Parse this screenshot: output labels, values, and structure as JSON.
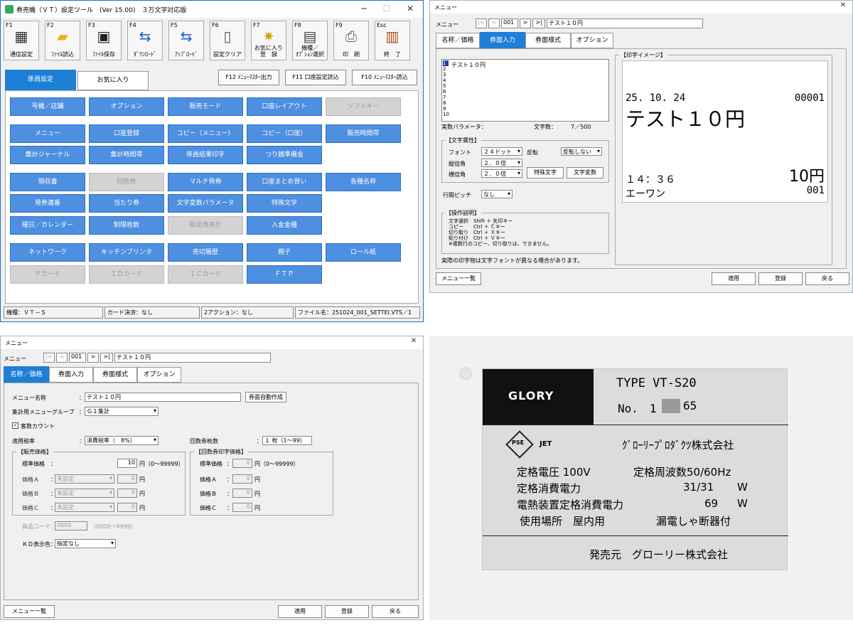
{
  "main": {
    "title": "券売機（ＶＴ）設定ツール　(Ver 15.00)　３万文字対応版",
    "toolbar": [
      {
        "key": "F1",
        "label": "通信設定",
        "icon": "network-icon"
      },
      {
        "key": "F2",
        "label": "ﾌｧｲﾙ読込",
        "icon": "folder-icon"
      },
      {
        "key": "F3",
        "label": "ﾌｧｲﾙ保存",
        "icon": "floppy-icon"
      },
      {
        "key": "F4",
        "label": "ﾀﾞｳﾝﾛｰﾄﾞ",
        "icon": "download-icon"
      },
      {
        "key": "F5",
        "label": "ｱｯﾌﾟﾛｰﾄﾞ",
        "icon": "upload-icon"
      },
      {
        "key": "F6",
        "label": "設定クリア",
        "icon": "document-icon"
      },
      {
        "key": "F7",
        "label": "お気に入り\n登　録",
        "icon": "star-folder-icon"
      },
      {
        "key": "F8",
        "label": "機種／\nｵﾌﾟｼｮﾝ選択",
        "icon": "machine-icon"
      },
      {
        "key": "F9",
        "label": "印　刷",
        "icon": "printer-icon"
      },
      {
        "key": "Esc",
        "label": "終　了",
        "icon": "exit-icon"
      }
    ],
    "tabs": [
      "係員設定",
      "お気に入り"
    ],
    "func_buttons": [
      "F12 ﾒﾆｭｰﾏｽﾀｰ出力",
      "F11 口座設定読込",
      "F10 ﾒﾆｭｰﾏｽﾀｰ読込"
    ],
    "menu_rows": [
      [
        "号機／店舗",
        "オプション",
        "販売モード",
        "口座レイアウト",
        "ソフトキー"
      ],
      [
        "メニュー",
        "口座登録",
        "コピー（メニュー）",
        "コピー（口座）",
        "販売時間帯"
      ],
      [
        "集計ジャーナル",
        "集計時間帯",
        "係員結果印字",
        "つり銭準備金",
        ""
      ],
      [
        "領収書",
        "回数券",
        "マルチ発券",
        "口座まとめ買い",
        "各種名称"
      ],
      [
        "発券連番",
        "当たり券",
        "文字変数パラメータ",
        "特殊文字",
        ""
      ],
      [
        "曜日／カレンダー",
        "制限枚数",
        "販促用表示",
        "入金金種",
        ""
      ],
      [
        "ネットワーク",
        "キッチンプリンタ",
        "売切履歴",
        "親子",
        "ロール紙"
      ],
      [
        "Ｐカード",
        "ＩＤカード",
        "ＩＣカード",
        "ＦＴＰ",
        ""
      ]
    ],
    "status": [
      "機種：ＶＴ－Ｓ",
      "カード決済：なし",
      "2アクション：なし",
      "ファイル名：251024_001_SETTEI.VTS／1"
    ]
  },
  "ticket": {
    "title": "メニュー",
    "nav_label": "メニュー",
    "nav_num": "001",
    "nav_name": "テスト１０円",
    "tabs": [
      "名称／価格",
      "券面入力",
      "券面様式",
      "オプション"
    ],
    "editor_first_line": "テスト１０円",
    "line_numbers": [
      "1",
      "2",
      "3",
      "4",
      "5",
      "6",
      "7",
      "8",
      "9",
      "10"
    ],
    "param_label": "実数パラメータ：",
    "char_count_label": "文字数：",
    "char_count": "7／500",
    "attr_group": "【文字属性】",
    "font_label": "フォント",
    "font_value": "２４ドット",
    "invert_label": "反転",
    "invert_value": "反転しない",
    "vert_label": "縦倍角",
    "vert_value": "２．０倍",
    "horiz_label": "横倍角",
    "horiz_value": "２．０倍",
    "special_btn": "特殊文字",
    "var_btn": "文字変数",
    "pitch_label": "行間ピッチ",
    "pitch_value": "なし",
    "help_group": "【操作説明】",
    "help_lines": [
      "文字選択　Shift ＋ 矢印キー",
      "コピー　　Ctrl ＋ Ｃキー",
      "切り取り　Ctrl ＋ Ｘキー",
      "貼り付け　Ctrl ＋ Ｖキー",
      "※複数行のコピー、切り取りは、できません。"
    ],
    "note": "実際の印字物は文字フォントが異なる場合があります。",
    "preview_group": "【印字イメージ】",
    "preview": {
      "date": "25. 10. 24",
      "serial": "00001",
      "name": "テスト１０円",
      "time": "１４：３６",
      "price": "10円",
      "shop": "エーワン",
      "num": "001"
    },
    "bottom": {
      "list": "メニュー一覧",
      "apply": "適用",
      "register": "登録",
      "back": "戻る"
    }
  },
  "price": {
    "title": "メニュー",
    "nav_label": "メニュー",
    "nav_num": "001",
    "nav_name": "テスト１０円",
    "tabs": [
      "名称／価格",
      "券面入力",
      "券面様式",
      "オプション"
    ],
    "menu_name_label": "メニュー名称",
    "menu_name": "テスト１０円",
    "auto_btn": "券面自動作成",
    "group_label": "集計用メニューグループ",
    "group_value": "Ｇ１集計",
    "guest_count": "客数カウント",
    "tax_label": "適用税率",
    "tax_value": "消費税率（　8%）",
    "coupon_label": "回数券枚数",
    "coupon_value": "１ 枚（1～99）",
    "sale_group": "【販売価格】",
    "coupon_group": "【回数券印字価格】",
    "std_label": "標準価格",
    "std_value": "10",
    "std_range": "円（0～99999）",
    "coupon_std_value": "0",
    "coupon_std_range": "円（0～99999）",
    "price_rows": [
      {
        "label": "価格Ａ",
        "sel": "未設定",
        "value": "0",
        "unit": "円"
      },
      {
        "label": "価格Ｂ",
        "sel": "未設定",
        "value": "0",
        "unit": "円"
      },
      {
        "label": "価格Ｃ",
        "sel": "未設定",
        "value": "0",
        "unit": "円"
      }
    ],
    "coupon_rows": [
      {
        "label": "価格Ａ",
        "value": "0",
        "unit": "円"
      },
      {
        "label": "価格Ｂ",
        "value": "0",
        "unit": "円"
      },
      {
        "label": "価格Ｃ",
        "value": "0",
        "unit": "円"
      }
    ],
    "product_code_label": "商品コード：",
    "product_code": "0000",
    "product_code_range": "（0000～9999）",
    "kd_label": "ＫＤ表示色：",
    "kd_value": "指定なし",
    "bottom": {
      "list": "メニュー一覧",
      "apply": "適用",
      "register": "登録",
      "back": "戻る"
    }
  },
  "plate": {
    "brand": "GLORY",
    "type": "TYPE VT-S20",
    "no_prefix": "No.　1",
    "no_suffix": "65",
    "pse": "PSE",
    "jet": "JET",
    "company": "ｸﾞﾛｰﾘｰﾌﾟﾛﾀﾞｸﾂ株式会社",
    "rows": [
      [
        "定格電圧 100V",
        "定格周波数50/60Hz"
      ],
      [
        "定格消費電力",
        "31/31",
        "W"
      ],
      [
        "電熱装置定格消費電力",
        "69",
        "W"
      ],
      [
        "使用場所　屋内用",
        "漏電しゃ断器付"
      ]
    ],
    "seller": "発売元　グローリー株式会社"
  }
}
